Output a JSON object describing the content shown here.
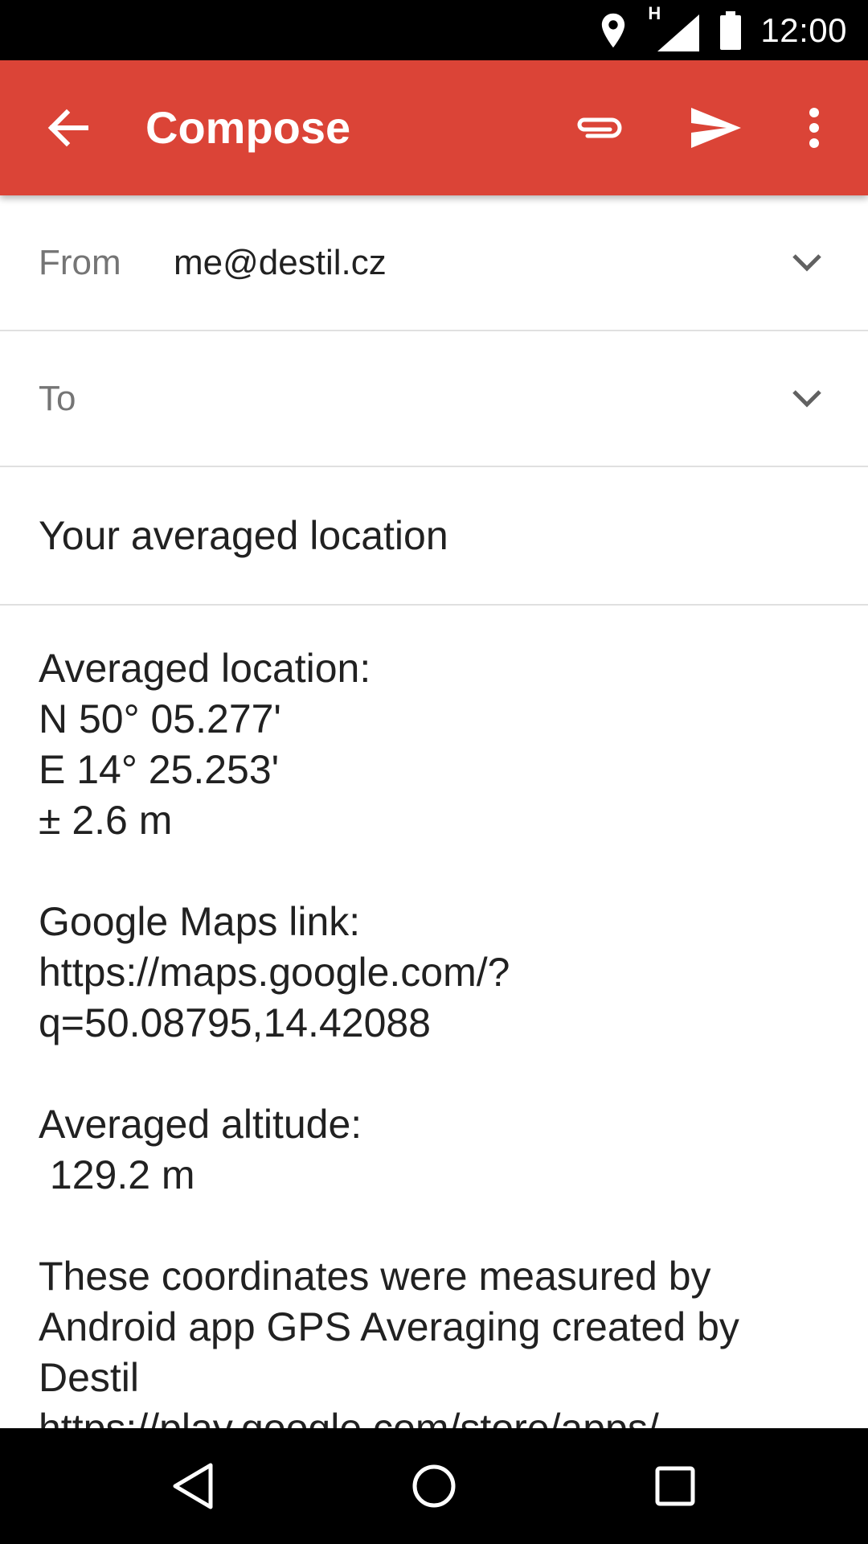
{
  "status_bar": {
    "time": "12:00",
    "network_type": "H",
    "icons": [
      "location-icon",
      "signal-icon",
      "battery-icon"
    ]
  },
  "app_bar": {
    "title": "Compose",
    "color": "#db4437",
    "actions": [
      "back-arrow-icon",
      "attach-icon",
      "send-icon",
      "overflow-menu-icon"
    ]
  },
  "compose": {
    "from_label": "From",
    "from_value": "me@destil.cz",
    "to_label": "To",
    "to_value": "",
    "subject": "Your averaged location",
    "body": "Averaged location:\nN 50° 05.277'\nE 14° 25.253'\n± 2.6 m\n\nGoogle Maps link:\nhttps://maps.google.com/?\nq=50.08795,14.42088\n\nAveraged altitude:\n 129.2 m\n\nThese coordinates were measured by Android app GPS Averaging created by Destil\nhttps://play.google.com/store/apps/"
  },
  "nav_bar": {
    "buttons": [
      "nav-back-icon",
      "nav-home-icon",
      "nav-recents-icon"
    ]
  }
}
